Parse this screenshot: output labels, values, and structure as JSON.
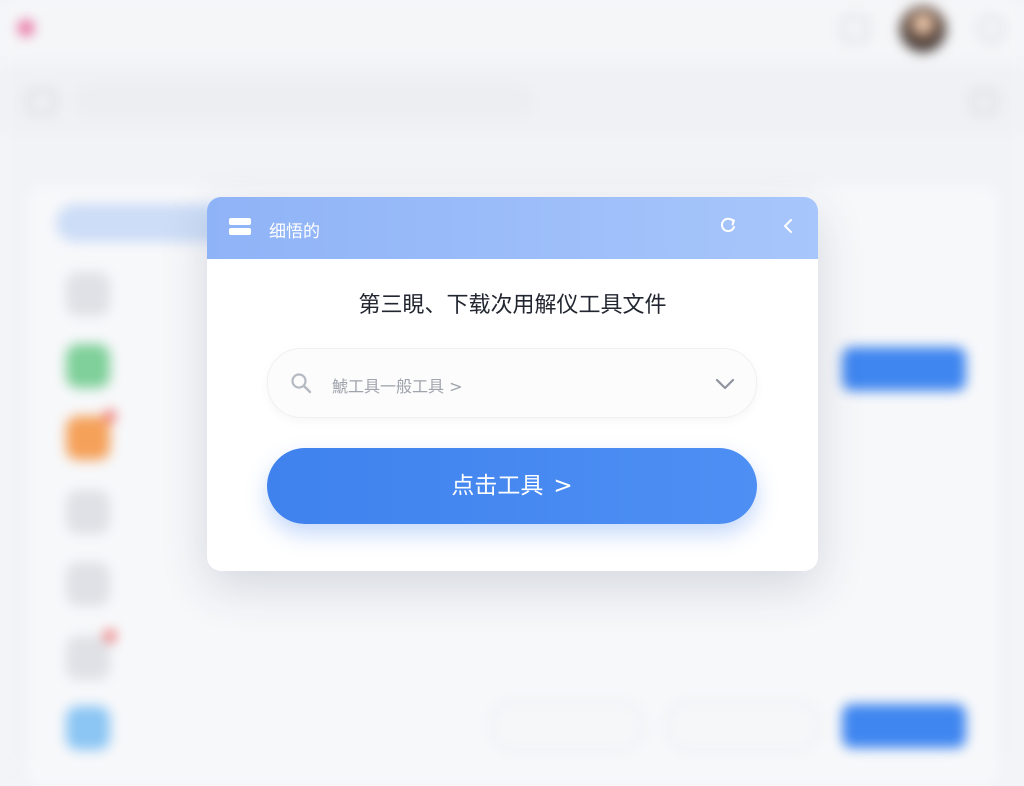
{
  "background": {
    "brand": "",
    "brand_sub": "",
    "search_placeholder": "",
    "filter_pill": "",
    "rows": [
      {
        "label": "",
        "color": "#dfe1e6",
        "badge": false
      },
      {
        "label": "",
        "color": "#7fd09a",
        "badge": false
      },
      {
        "label": "",
        "color": "#f5a15a",
        "badge": true
      },
      {
        "label": "",
        "color": "#dfe1e6",
        "badge": false
      },
      {
        "label": "",
        "color": "#dfe1e6",
        "badge": false
      },
      {
        "label": "",
        "color": "#dfe1e6",
        "badge": true
      },
      {
        "label": "",
        "color": "#8cc6f4",
        "badge": false
      }
    ],
    "row_button_label": "",
    "ghost_button_1": "",
    "ghost_button_2": ""
  },
  "modal": {
    "header_title": "细悟的",
    "title": "第三睍、下载次用解仪工具文件",
    "select_value": "鯱工具一般工具 >",
    "button_label": "点击工具",
    "button_chevron": ">",
    "refresh_icon": "refresh-icon",
    "back_icon": "chevron-left-icon",
    "accent_color": "#4a8bf2",
    "header_color": "#9bbdf9"
  }
}
